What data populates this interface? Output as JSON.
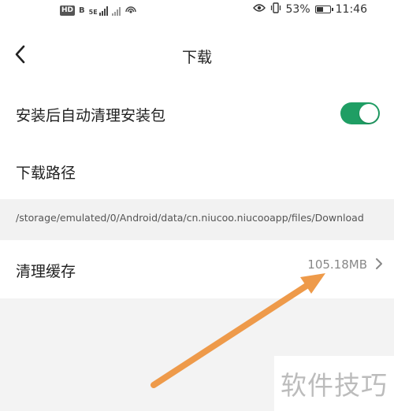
{
  "status_bar": {
    "hd_label": "HD",
    "hd_b_label": "B",
    "network_label": "5E",
    "battery_percent": "53%",
    "battery_level": 0.53,
    "time": "11:46"
  },
  "header": {
    "title": "下载",
    "back_icon": "back-chevron-icon"
  },
  "settings": {
    "auto_clean": {
      "label": "安装后自动清理安装包",
      "enabled": true,
      "accent_color": "#1f9e64"
    },
    "download_path": {
      "label": "下载路径",
      "value": "/storage/emulated/0/Android/data/cn.niucoo.niucooapp/files/Download"
    },
    "clear_cache": {
      "label": "清理缓存",
      "value": "105.18MB"
    }
  },
  "annotation": {
    "arrow_color": "#ee9a4a"
  },
  "watermark": {
    "text": "软件技巧"
  }
}
